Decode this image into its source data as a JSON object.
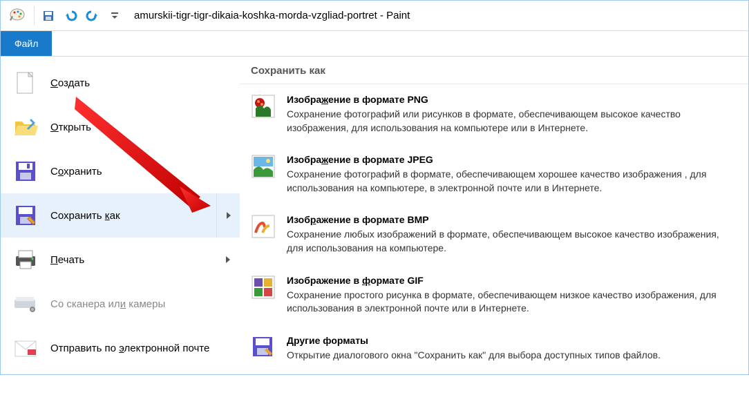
{
  "titlebar": {
    "title": "amurskii-tigr-tigr-dikaia-koshka-morda-vzgliad-portret - Paint"
  },
  "file_tab": {
    "label": "Файл"
  },
  "menu": {
    "new": "Создать",
    "open": "Открыть",
    "save": "Сохранить",
    "save_as": "Сохранить как",
    "print": "Печать",
    "scanner": "Со сканера или камеры",
    "email": "Отправить по электронной почте"
  },
  "panel": {
    "header": "Сохранить как",
    "formats": [
      {
        "title": "Изображение в формате PNG",
        "desc": "Сохранение фотографий или рисунков в формате, обеспечивающем высокое качество изображения, для использования на компьютере или в Интернете."
      },
      {
        "title": "Изображение в формате JPEG",
        "desc": "Сохранение фотографий в формате, обеспечивающем хорошее качество изображения , для использования на компьютере, в электронной почте или в Интернете."
      },
      {
        "title": "Изображение в формате BMP",
        "desc": "Сохранение любых изображений в формате, обеспечивающем высокое качество изображения, для использования на компьютере."
      },
      {
        "title": "Изображение в формате GIF",
        "desc": "Сохранение простого рисунка в формате, обеспечивающем низкое качество изображения, для использования в электронной почте или в Интернете."
      },
      {
        "title": "Другие форматы",
        "desc": "Открытие диалогового окна \"Сохранить как\" для выбора доступных типов файлов."
      }
    ]
  }
}
